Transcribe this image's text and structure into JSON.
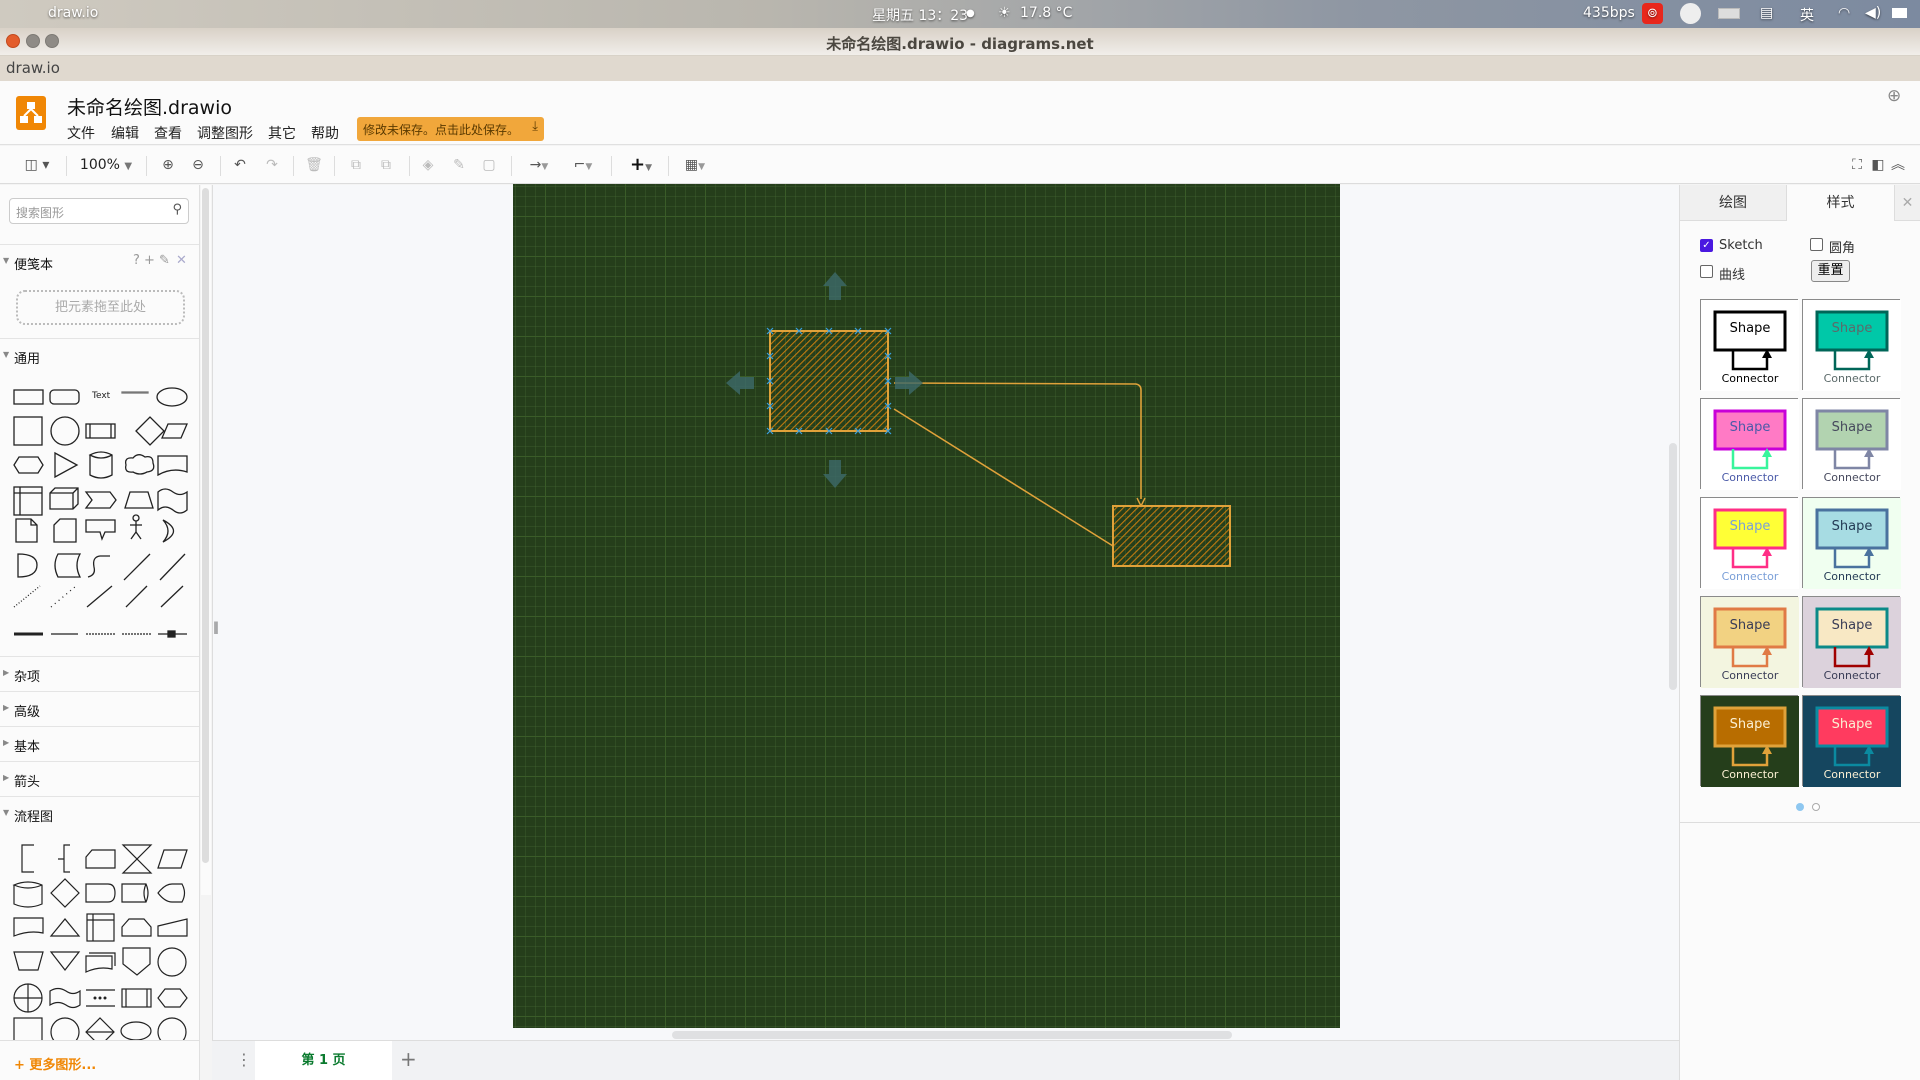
{
  "os_bar": {
    "app_name": "draw.io",
    "clock": "星期五 13：23",
    "weather": "17.8 °C",
    "net_speed": "435bps",
    "input_method": "英"
  },
  "window": {
    "title": "未命名绘图.drawio - diagrams.net",
    "app_menu": "draw.io"
  },
  "header": {
    "doc_title": "未命名绘图.drawio",
    "menus": [
      "文件",
      "编辑",
      "查看",
      "调整图形",
      "其它",
      "帮助"
    ],
    "save_banner": "修改未保存。点击此处保存。"
  },
  "toolbar": {
    "zoom": "100%",
    "icons": [
      "format-panel-icon",
      "zoom-in-icon",
      "zoom-out-icon",
      "undo-icon",
      "redo-icon",
      "delete-icon",
      "to-front-icon",
      "to-back-icon",
      "fill-color-icon",
      "line-color-icon",
      "shadow-icon",
      "connection-icon",
      "waypoints-icon",
      "insert-icon",
      "table-icon",
      "fullscreen-icon",
      "toggle-panel-icon",
      "collapse-icon"
    ]
  },
  "sidebar": {
    "search_placeholder": "搜索图形",
    "scratchpad": {
      "title": "便笺本",
      "drop_hint": "把元素拖至此处",
      "actions": [
        "?",
        "+",
        "✎",
        "✕"
      ]
    },
    "sections": [
      {
        "label": "通用",
        "expanded": true
      },
      {
        "label": "杂项",
        "expanded": false
      },
      {
        "label": "高级",
        "expanded": false
      },
      {
        "label": "基本",
        "expanded": false
      },
      {
        "label": "箭头",
        "expanded": false
      },
      {
        "label": "流程图",
        "expanded": true
      }
    ],
    "text_shape_label": "Text",
    "more_shapes": "+ 更多图形..."
  },
  "pages": {
    "current": "第 1 页"
  },
  "diagram": {
    "background": "#253e1b",
    "stroke": "#e0a23a",
    "fill": "#b86d00",
    "shapes": [
      {
        "id": "box-1",
        "selected": true,
        "style": "sketch-hachure"
      },
      {
        "id": "box-2",
        "selected": false,
        "style": "sketch-hachure"
      }
    ],
    "edges": [
      {
        "from": "box-1",
        "to": "box-2",
        "type": "orthogonal",
        "arrow": true
      },
      {
        "from": "box-1",
        "to": "box-2",
        "type": "straight",
        "arrow": false
      }
    ]
  },
  "format_panel": {
    "tabs": [
      "绘图",
      "样式"
    ],
    "active_tab": "样式",
    "options": {
      "sketch": {
        "label": "Sketch",
        "checked": true
      },
      "rounded": {
        "label": "圆角",
        "checked": false
      },
      "curved": {
        "label": "曲线",
        "checked": false
      }
    },
    "reset_label": "重置",
    "themes": [
      {
        "shape": "Shape",
        "connector": "Connector",
        "bg": "#ffffff",
        "fill": "#ffffff",
        "stroke": "#000000",
        "text": "#000000",
        "edge": "#000000"
      },
      {
        "shape": "Shape",
        "connector": "Connector",
        "bg": "#ffffff",
        "fill": "#00c8a8",
        "stroke": "#006658",
        "text": "#5c6a6a",
        "edge": "#006658"
      },
      {
        "shape": "Shape",
        "connector": "Connector",
        "bg": "#ffffff",
        "fill": "#ff7ac5",
        "stroke": "#c800d8",
        "text": "#4a5aa8",
        "edge": "#38f59c"
      },
      {
        "shape": "Shape",
        "connector": "Connector",
        "bg": "#ffffff",
        "fill": "#b2d3b0",
        "stroke": "#7f86a5",
        "text": "#46495d",
        "edge": "#7f86a5"
      },
      {
        "shape": "Shape",
        "connector": "Connector",
        "bg": "#ffffff",
        "fill": "#ffff36",
        "stroke": "#ff2e86",
        "text": "#7a9fd8",
        "edge": "#ff2e86"
      },
      {
        "shape": "Shape",
        "connector": "Connector",
        "bg": "#f0fff0",
        "fill": "#a7dce3",
        "stroke": "#4a729e",
        "text": "#243b55",
        "edge": "#4a729e"
      },
      {
        "shape": "Shape",
        "connector": "Connector",
        "bg": "#f3f5e0",
        "fill": "#f2d282",
        "stroke": "#e07a45",
        "text": "#393c56",
        "edge": "#e07a45"
      },
      {
        "shape": "Shape",
        "connector": "Connector",
        "bg": "#dcd2dc",
        "fill": "#f8e8c4",
        "stroke": "#0b8a88",
        "text": "#393c56",
        "edge": "#a00000"
      },
      {
        "shape": "Shape",
        "connector": "Connector",
        "bg": "#253e1b",
        "fill": "#b86d00",
        "stroke": "#e0a23a",
        "text": "#fbf0d3",
        "edge": "#e0a23a"
      },
      {
        "shape": "Shape",
        "connector": "Connector",
        "bg": "#15465f",
        "fill": "#ff3b5f",
        "stroke": "#0b8aa0",
        "text": "#fbf0d3",
        "edge": "#0b8aa0"
      }
    ],
    "theme_page": 1,
    "theme_pages": 2
  }
}
